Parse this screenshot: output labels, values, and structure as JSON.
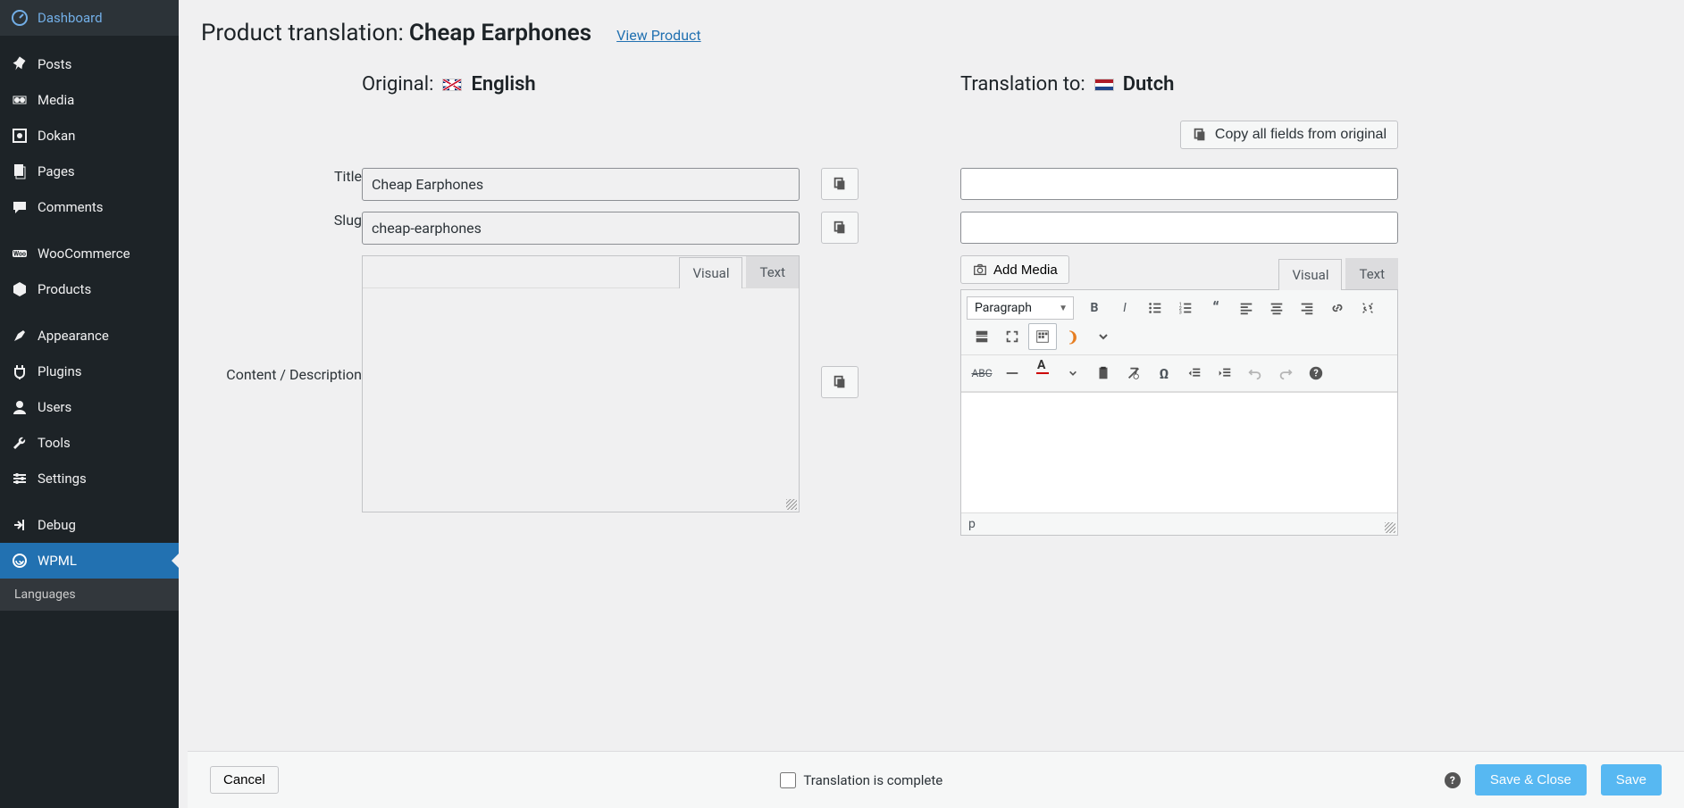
{
  "sidebar": {
    "items": [
      {
        "label": "Dashboard"
      },
      {
        "label": "Posts"
      },
      {
        "label": "Media"
      },
      {
        "label": "Dokan"
      },
      {
        "label": "Pages"
      },
      {
        "label": "Comments"
      },
      {
        "label": "WooCommerce"
      },
      {
        "label": "Products"
      },
      {
        "label": "Appearance"
      },
      {
        "label": "Plugins"
      },
      {
        "label": "Users"
      },
      {
        "label": "Tools"
      },
      {
        "label": "Settings"
      },
      {
        "label": "Debug"
      },
      {
        "label": "WPML"
      },
      {
        "label": "Languages"
      }
    ]
  },
  "header": {
    "prefix": "Product translation:",
    "title": "Cheap Earphones",
    "view_link": "View Product"
  },
  "original": {
    "label": "Original:",
    "lang": "English"
  },
  "translation": {
    "label": "Translation to:",
    "lang": "Dutch",
    "copy_all": "Copy all fields from original"
  },
  "fields": {
    "title_label": "Title",
    "title_value": "Cheap Earphones",
    "slug_label": "Slug",
    "slug_value": "cheap-earphones",
    "content_label": "Content / Description"
  },
  "editor": {
    "visual_tab": "Visual",
    "text_tab": "Text",
    "add_media": "Add Media",
    "format_select": "Paragraph",
    "status_path": "p"
  },
  "footer": {
    "cancel": "Cancel",
    "complete": "Translation is complete",
    "save_close": "Save & Close",
    "save": "Save"
  }
}
